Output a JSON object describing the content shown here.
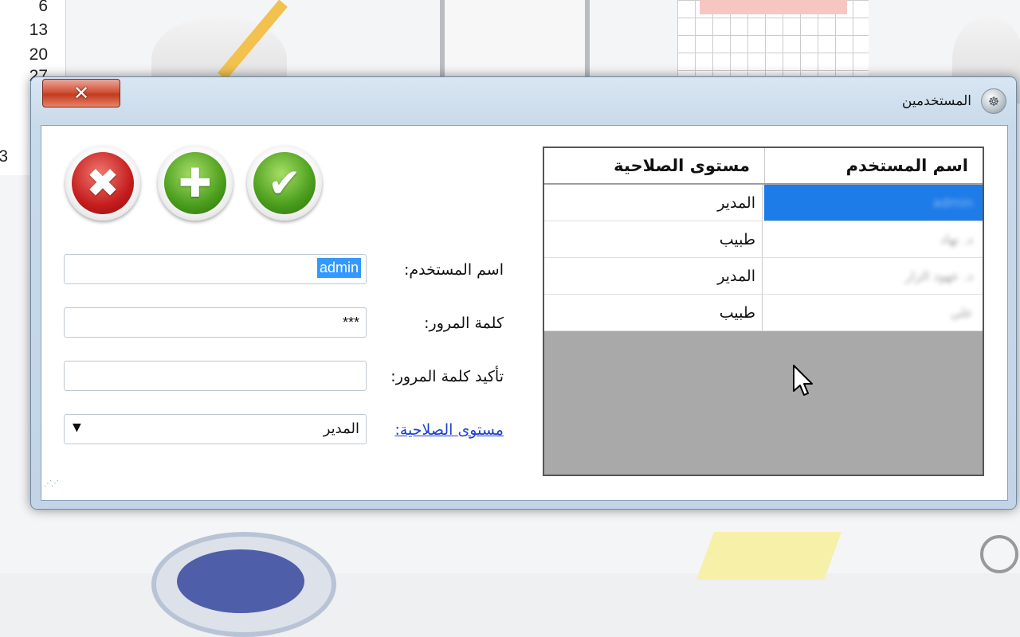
{
  "background": {
    "row_numbers": [
      "6",
      "13",
      "20",
      "27",
      "3"
    ]
  },
  "window": {
    "title": "المستخدمين",
    "close_glyph": "✕",
    "app_icon_glyph": "☸"
  },
  "actions": {
    "cancel_glyph": "✖",
    "add_glyph": "✚",
    "confirm_glyph": "✔"
  },
  "form": {
    "username_label": "اسم المستخدم:",
    "username_value": "admin",
    "password_label": "كلمة المرور:",
    "password_value": "***",
    "confirm_label": "تأكيد كلمة المرور:",
    "confirm_value": "",
    "level_label": "مستوى الصلاحية:",
    "level_value": "المدير",
    "dropdown_arrow": "▼"
  },
  "grid": {
    "columns": [
      "اسم المستخدم",
      "مستوى الصلاحية"
    ],
    "rows": [
      {
        "name": "admin",
        "level": "المدير"
      },
      {
        "name": "د. نهاد",
        "level": "طبيب"
      },
      {
        "name": "د. عهود الزار",
        "level": "المدير"
      },
      {
        "name": "علي",
        "level": "طبيب"
      }
    ]
  },
  "colors": {
    "selection": "#1e7ce8",
    "link": "#1a3fd0",
    "close": "#c23b20"
  }
}
